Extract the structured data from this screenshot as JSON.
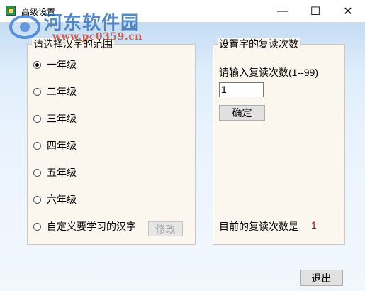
{
  "window": {
    "title": "高级设置",
    "minimize_symbol": "—",
    "maximize_symbol": "☐",
    "close_symbol": "✕"
  },
  "watermark": {
    "site_name": "河东软件园",
    "url": "www.pc0359.cn"
  },
  "left_group": {
    "title": "请选择汉字的范围",
    "options": [
      {
        "label": "一年级",
        "checked": true
      },
      {
        "label": "二年级",
        "checked": false
      },
      {
        "label": "三年级",
        "checked": false
      },
      {
        "label": "四年级",
        "checked": false
      },
      {
        "label": "五年级",
        "checked": false
      },
      {
        "label": "六年级",
        "checked": false
      },
      {
        "label": "自定义要学习的汉字",
        "checked": false
      }
    ],
    "modify_button": "修改"
  },
  "right_group": {
    "title": "设置字的复读次数",
    "prompt": "请输入复读次数(1--99)",
    "input_value": "1",
    "confirm_button": "确定",
    "current_label": "目前的复读次数是",
    "current_value": "1"
  },
  "footer": {
    "exit_button": "退出"
  },
  "colors": {
    "accent_red": "#c00000",
    "group_bg": "#fbf7ef",
    "client_gradient_top": "#c5dcf3"
  }
}
